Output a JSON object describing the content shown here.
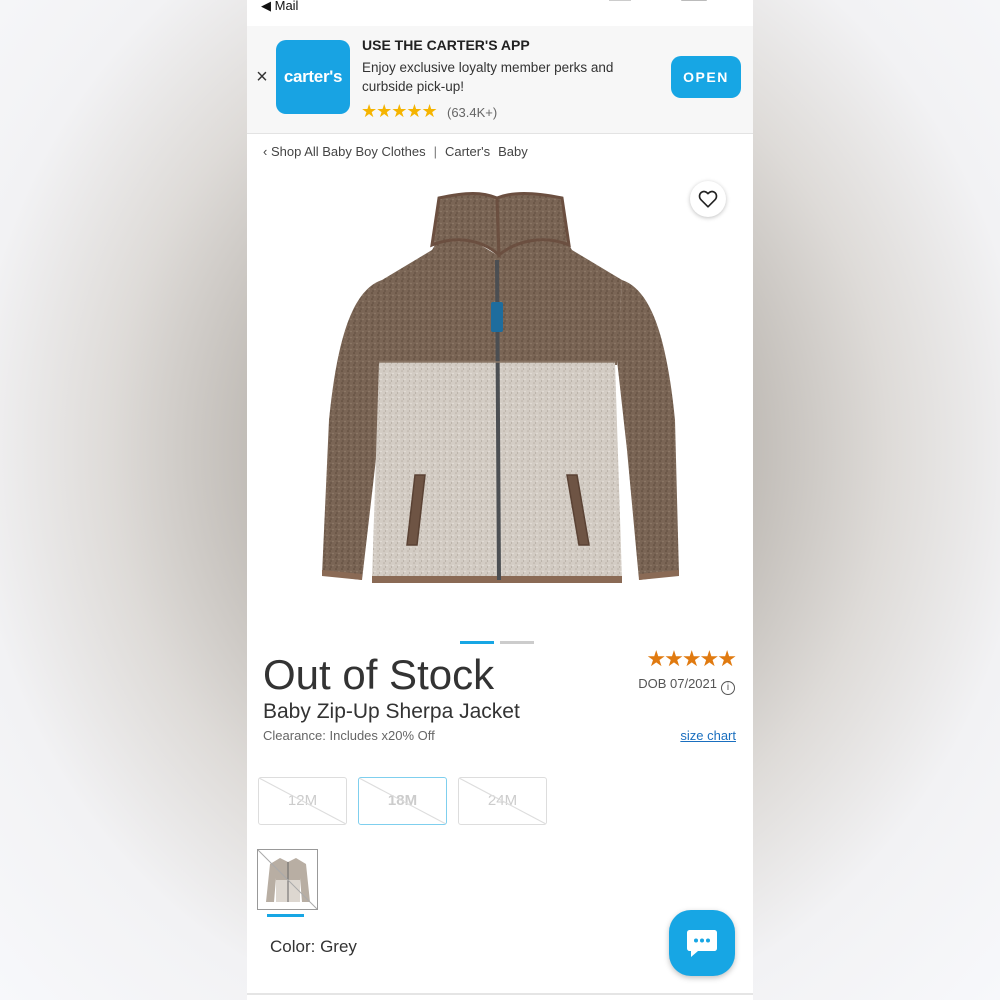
{
  "status_bar": {
    "back_label": "◀ Mail"
  },
  "app_banner": {
    "close_icon": "×",
    "logo_text": "carter's",
    "title": "USE THE CARTER'S APP",
    "description": "Enjoy exclusive loyalty member perks and curbside pick-up!",
    "stars": "★★★★★",
    "rating_count": "(63.4K+)",
    "open_label": "OPEN",
    "accent_color": "#17a6e4"
  },
  "breadcrumb": {
    "back": "‹ Shop All Baby Boy Clothes",
    "separator": "|",
    "brand": "Carter's",
    "category": "Baby"
  },
  "product": {
    "favorite_icon": "heart-icon",
    "image_count": 2,
    "active_image": 1,
    "stock_status": "Out of Stock",
    "name": "Baby Zip-Up Sherpa Jacket",
    "clearance": "Clearance: Includes x20% Off",
    "rating_stars": "★★★★★",
    "rating_color": "#e07a10",
    "dob": "DOB 07/2021",
    "info_icon": "i",
    "size_chart_label": "size chart",
    "sizes": [
      {
        "label": "12M",
        "available": false,
        "selected": false
      },
      {
        "label": "18M",
        "available": false,
        "selected": true
      },
      {
        "label": "24M",
        "available": false,
        "selected": false
      }
    ],
    "color_label": "Color: Grey"
  },
  "chat": {
    "icon": "chat-bubble-icon"
  }
}
